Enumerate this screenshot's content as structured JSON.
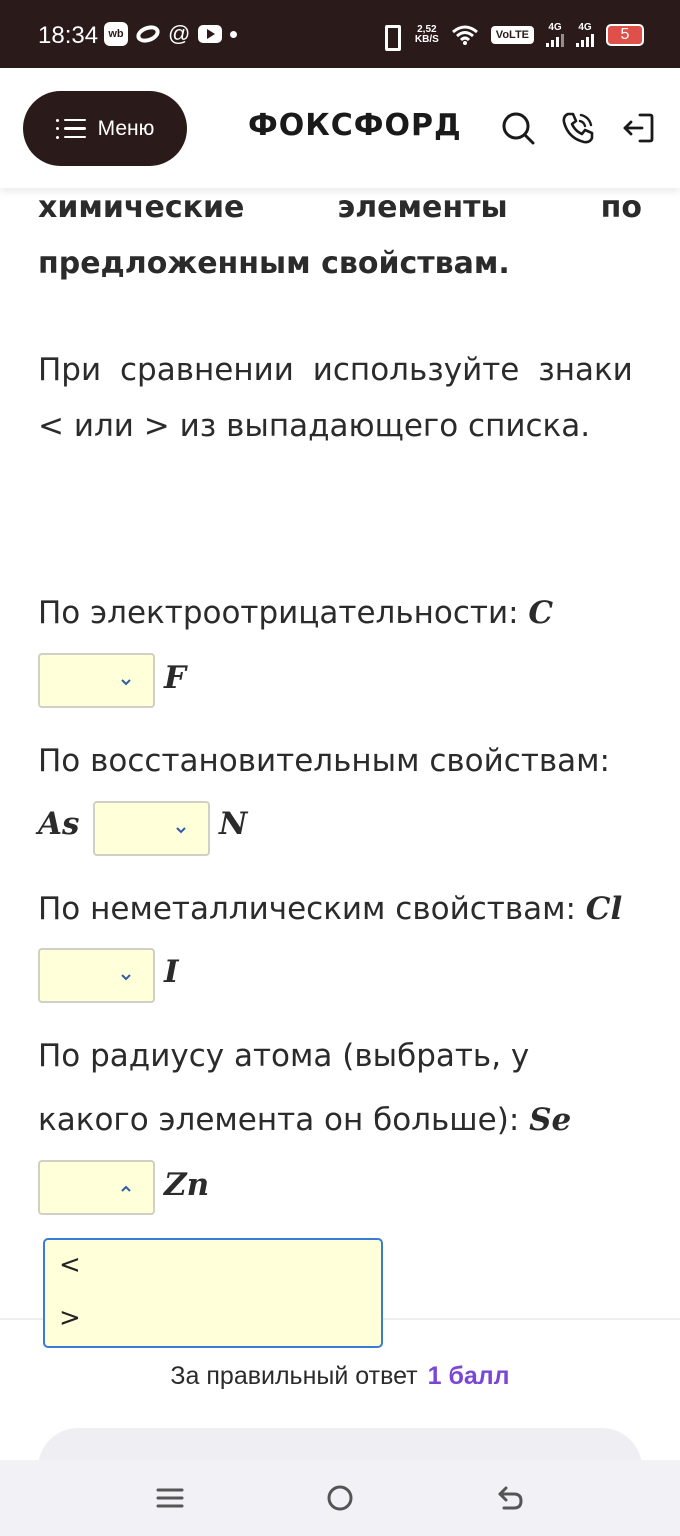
{
  "statusbar": {
    "time": "18:34",
    "app_badge": "wb",
    "at_sign": "@",
    "speed_value": "2,52",
    "speed_unit": "KB/S",
    "volte": "VoLTE",
    "net1": "4G",
    "net2": "4G",
    "battery": "5"
  },
  "header": {
    "menu_label": "Меню",
    "logo": "ФОКСФОРД"
  },
  "task": {
    "line1_words": [
      "химические",
      "элементы",
      "по"
    ],
    "line2": "предложенным свойствам.",
    "hint_line1": "При сравнении используйте знаки",
    "hint_line2": "< или > из выпадающего списка.",
    "q1_text": "По электроотрицательности:",
    "q1_left": "C",
    "q1_right": "F",
    "q2_text": "По восстановительным свойствам:",
    "q2_left": "As",
    "q2_right": "N",
    "q3_text": "По неметаллическим свойствам:",
    "q3_left": "Cl",
    "q3_right": "I",
    "q4_text_line1": "По радиусу атома (выбрать, у",
    "q4_text_line2": "какого элемента он больше):",
    "q4_left": "Se",
    "q4_right": "Zn"
  },
  "dropdown_options": [
    "<",
    ">"
  ],
  "score": {
    "label": "За правильный ответ",
    "points": "1 балл"
  }
}
